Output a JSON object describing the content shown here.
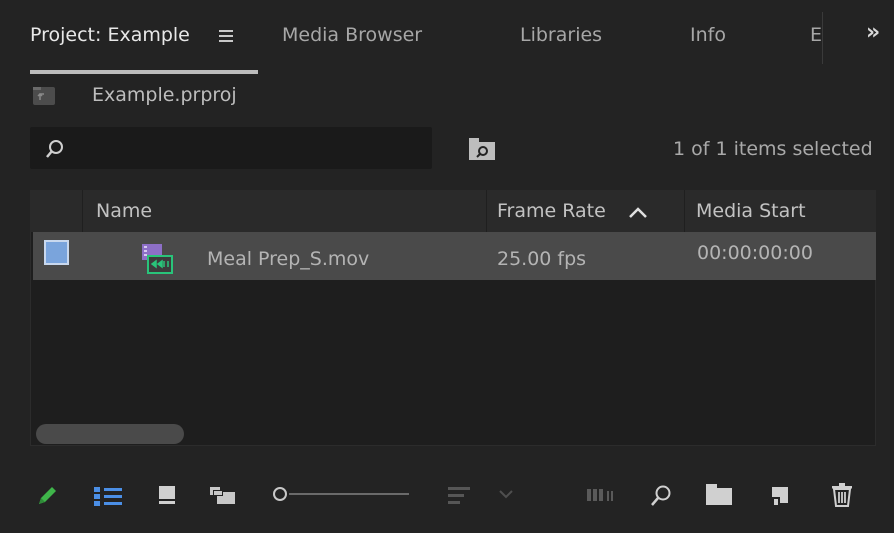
{
  "tabs": [
    {
      "label": "Project: Example",
      "active": true
    },
    {
      "label": "Media Browser"
    },
    {
      "label": "Libraries"
    },
    {
      "label": "Info"
    },
    {
      "label": "E"
    }
  ],
  "tab_menu_icon": "hamburger-menu-icon",
  "overflow_label": "»",
  "breadcrumb": {
    "label": "Example.prproj",
    "icon": "parent-folder-icon"
  },
  "search": {
    "value": "",
    "placeholder": ""
  },
  "selection_info": "1 of 1 items selected",
  "columns": [
    {
      "label": "Name"
    },
    {
      "label": "Frame Rate"
    },
    {
      "label": "Media Start"
    }
  ],
  "sort": {
    "column": "Frame Rate",
    "direction": "ascending"
  },
  "rows": [
    {
      "name": "Meal Prep_S.mov",
      "frame_rate": "25.00 fps",
      "media_start": "00:00:00:00",
      "selected": true,
      "label_color": "#7aa4dc",
      "icon": "video-clip-icon"
    }
  ],
  "colors": {
    "accent_blue": "#4b8fe6",
    "pencil_green": "#3fb54a",
    "row_label": "#7aa4dc"
  },
  "toolbar_icons": [
    "pencil-icon",
    "list-view-icon",
    "icon-view-icon",
    "freeform-view-icon",
    "zoom-slider",
    "sort-icons-icon",
    "automate-to-sequence-icon",
    "find-icon",
    "new-bin-icon",
    "new-item-icon",
    "trash-icon"
  ]
}
